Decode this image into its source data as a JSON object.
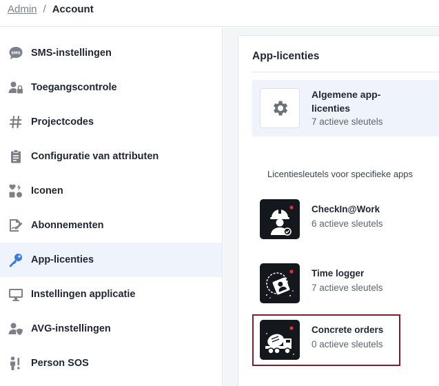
{
  "breadcrumb": {
    "parent": "Admin",
    "separator": "/",
    "current": "Account"
  },
  "sidebar": {
    "items": [
      {
        "label": "SMS-instellingen",
        "icon": "sms-icon"
      },
      {
        "label": "Toegangscontrole",
        "icon": "user-lock-icon"
      },
      {
        "label": "Projectcodes",
        "icon": "hashtag-icon"
      },
      {
        "label": "Configuratie van attributen",
        "icon": "clipboard-icon"
      },
      {
        "label": "Iconen",
        "icon": "icons-icon"
      },
      {
        "label": "Abonnementen",
        "icon": "file-signature-icon"
      },
      {
        "label": "App-licenties",
        "icon": "key-icon",
        "active": true
      },
      {
        "label": "Instellingen applicatie",
        "icon": "monitor-icon"
      },
      {
        "label": "AVG-instellingen",
        "icon": "user-shield-icon"
      },
      {
        "label": "Person SOS",
        "icon": "person-sos-icon"
      }
    ]
  },
  "panel": {
    "title": "App-licenties",
    "general": {
      "title": "Algemene app-licenties",
      "subtitle": "7 actieve sleutels",
      "icon": "gear-icon"
    },
    "section_label": "Licentiesleutels voor specifieke apps",
    "apps": [
      {
        "title": "CheckIn@Work",
        "subtitle": "6 actieve sleutels",
        "icon": "worker-helmet-icon"
      },
      {
        "title": "Time logger",
        "subtitle": "7 actieve sleutels",
        "icon": "time-logger-icon"
      },
      {
        "title": "Concrete orders",
        "subtitle": "0 actieve sleutels",
        "icon": "concrete-truck-icon",
        "selected": true
      }
    ]
  },
  "colors": {
    "text": "#1f2532",
    "muted": "#5e646d",
    "active_bg": "#eff3fb",
    "accent_blue": "#3b7ddd",
    "selected_border": "#7c1d2a",
    "icon_dark": "#14171c",
    "icon_red": "#e0303a"
  }
}
